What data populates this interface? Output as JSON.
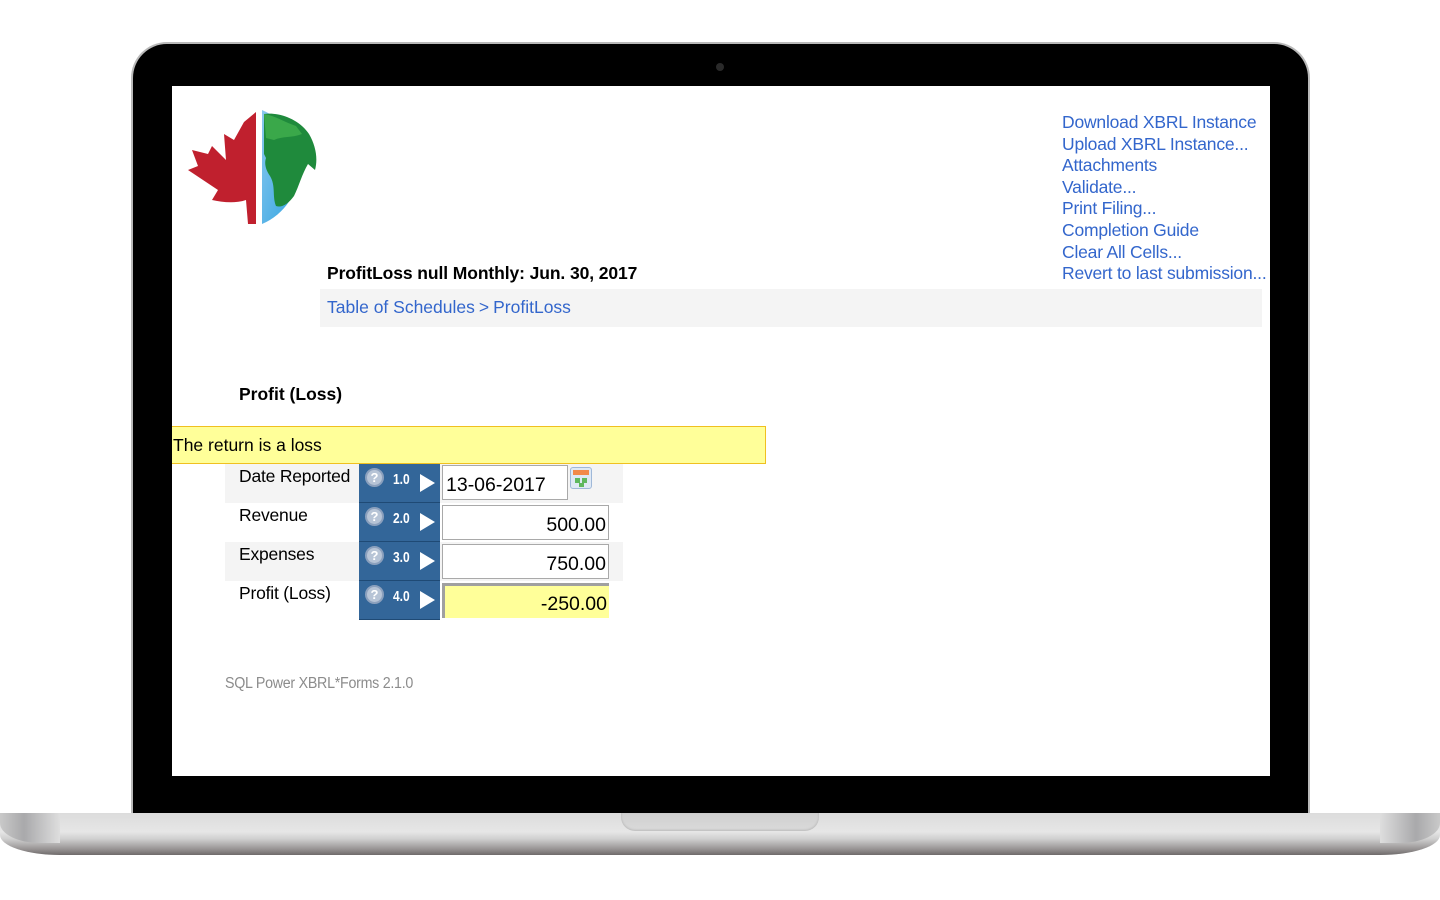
{
  "header": {
    "logo_alt": "maple leaf and globe logo",
    "links": [
      "Download XBRL Instance",
      "Upload XBRL Instance...",
      "Attachments",
      "Validate...",
      "Print Filing...",
      "Completion Guide",
      "Clear All Cells...",
      "Revert to last submission..."
    ]
  },
  "page": {
    "title": "ProfitLoss null Monthly: Jun. 30, 2017",
    "breadcrumb": {
      "root": "Table of Schedules",
      "separator": ">",
      "current": "ProfitLoss"
    },
    "section_title": "Profit (Loss)",
    "alert": "The return is a loss"
  },
  "form": {
    "rows": [
      {
        "label": "Date Reported",
        "code": "1.0",
        "value": "13-06-2017",
        "type": "date"
      },
      {
        "label": "Revenue",
        "code": "2.0",
        "value": "500.00",
        "type": "number"
      },
      {
        "label": "Expenses",
        "code": "3.0",
        "value": "750.00",
        "type": "number"
      },
      {
        "label": "Profit (Loss)",
        "code": "4.0",
        "value": "-250.00",
        "type": "computed"
      }
    ],
    "help_glyph": "?"
  },
  "footer": "SQL Power XBRL*Forms 2.1.0",
  "colors": {
    "link": "#3366cc",
    "code_cell": "#336699",
    "alert_bg": "#ffff99",
    "alert_border": "#f0c020",
    "computed_bg": "#ffff99"
  }
}
